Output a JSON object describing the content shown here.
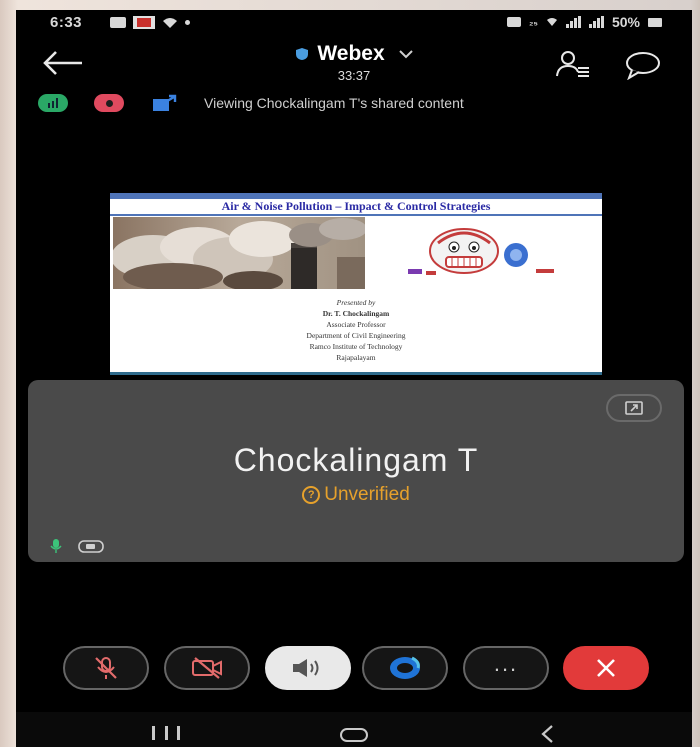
{
  "status_bar": {
    "time": "6:33",
    "battery": "50%"
  },
  "header": {
    "app_name": "Webex",
    "timer": "33:37"
  },
  "info": {
    "viewing_text": "Viewing Chockalingam T's shared content"
  },
  "slide": {
    "title": "Air & Noise Pollution – Impact & Control Strategies",
    "presented_by": "Presented by",
    "author": "Dr. T. Chockalingam",
    "role": "Associate Professor",
    "department": "Department of Civil Engineering",
    "institute": "Ramco Institute of Technology",
    "place": "Rajapalayam"
  },
  "participant": {
    "name": "Chockalingam T",
    "status": "Unverified"
  },
  "controls": {
    "more": "..."
  },
  "colors": {
    "background": "#000000",
    "tile": "#4a4a4a",
    "unverified": "#e6a12c",
    "leave": "#e23a3a",
    "speaker_active": "#e9e9e9",
    "slide_title": "#2a2aa4"
  },
  "icons": [
    "back-arrow-icon",
    "shield-icon",
    "chevron-down-icon",
    "participants-icon",
    "chat-icon",
    "audio-stats-icon",
    "recording-icon",
    "share-icon",
    "expand-icon",
    "mic-icon",
    "camera-icon",
    "mic-muted-icon",
    "video-off-icon",
    "speaker-icon",
    "share-screen-icon",
    "more-icon",
    "close-icon"
  ]
}
